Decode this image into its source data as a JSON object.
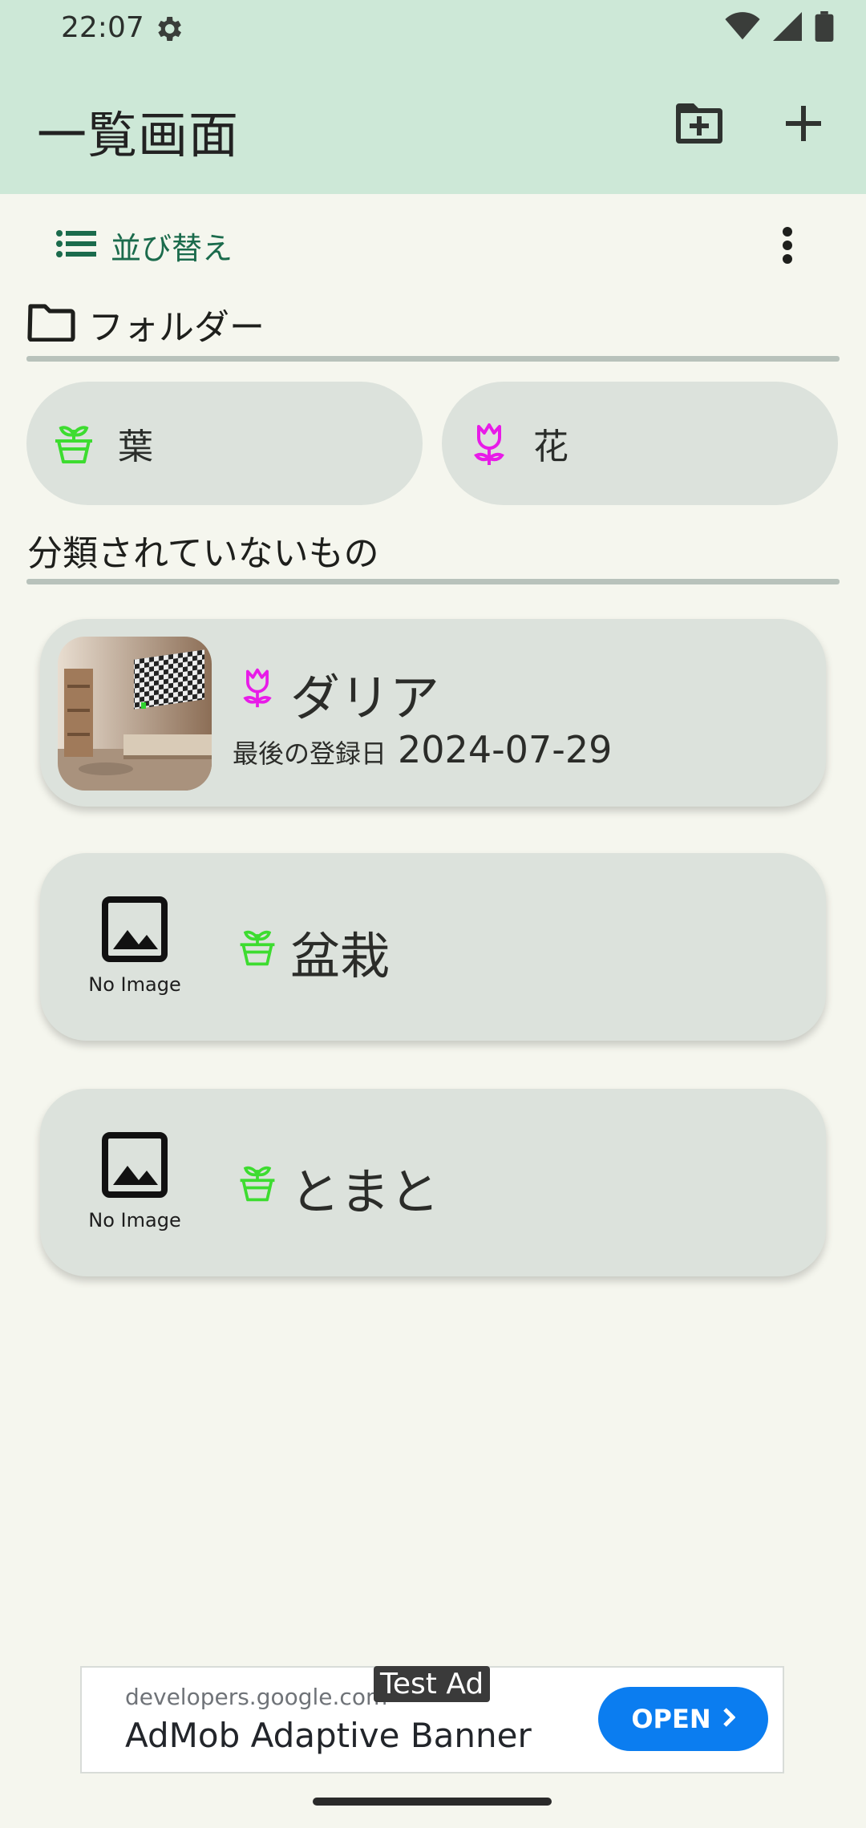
{
  "status_bar": {
    "time": "22:07"
  },
  "app_bar": {
    "title": "一覧画面"
  },
  "toolbar": {
    "sort_label": "並び替え"
  },
  "folders": {
    "section_title": "フォルダー",
    "items": [
      {
        "label": "葉",
        "icon": "seedling-pot-icon",
        "color": "#3ddc30"
      },
      {
        "label": "花",
        "icon": "tulip-icon",
        "color": "#e81be8"
      }
    ]
  },
  "uncategorized": {
    "section_title": "分類されていないもの",
    "plants": [
      {
        "name": "ダリア",
        "icon": "tulip-icon",
        "has_image": true,
        "date_label": "最後の登録日",
        "date": "2024-07-29"
      },
      {
        "name": "盆栽",
        "icon": "seedling-pot-icon",
        "has_image": false,
        "no_image_label": "No Image"
      },
      {
        "name": "とまと",
        "icon": "seedling-pot-icon",
        "has_image": false,
        "no_image_label": "No Image"
      }
    ]
  },
  "ad": {
    "badge": "Test Ad",
    "domain": "developers.google.com",
    "title": "AdMob Adaptive Banner",
    "open_label": "OPEN"
  },
  "colors": {
    "app_bar_bg": "#cde8d7",
    "page_bg": "#f5f6ee",
    "card_bg": "#dce2dc",
    "accent_green": "#1b6b4c",
    "leaf_icon": "#3ddc30",
    "flower_icon": "#e81be8",
    "ad_button": "#0b7df0"
  }
}
